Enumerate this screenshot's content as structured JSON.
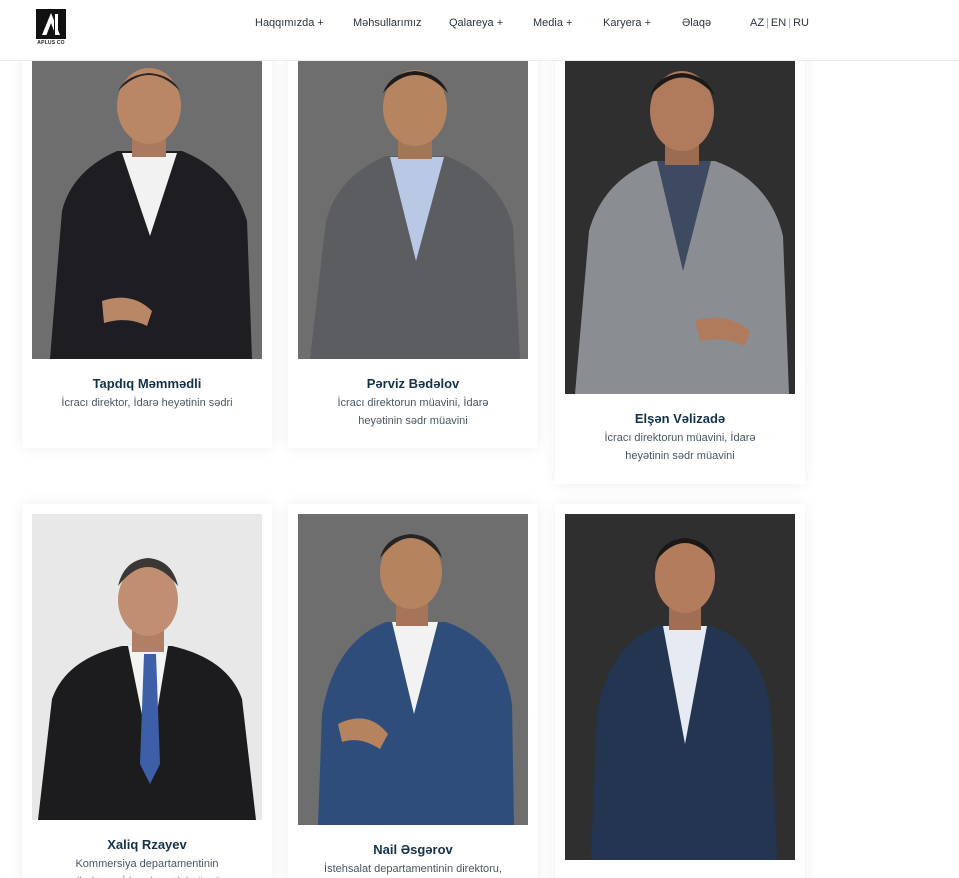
{
  "header": {
    "logo_text": "APLUS CO",
    "nav": [
      "Haqqımızda +",
      "Məhsullarımız",
      "Qalareya +",
      "Media +",
      "Karyera +",
      "Əlaqə"
    ],
    "languages": [
      "AZ",
      "EN",
      "RU"
    ]
  },
  "team": [
    {
      "name": "Tapdıq Məmmədli",
      "role": "İcracı direktor, İdarə heyətinin sədri"
    },
    {
      "name": "Pərviz Bədəlov",
      "role": "İcracı direktorun müavini, İdarə heyətinin sədr müavini"
    },
    {
      "name": "Elşən Vəlizadə",
      "role": "İcracı direktorun müavini, İdarə heyətinin sədr müavini"
    },
    {
      "name": "Xaliq Rzayev",
      "role": "Kommersiya departamentinin direktoru, İdarə heyətinin üzvü"
    },
    {
      "name": "Nail Əsgərov",
      "role": "İstehsalat departamentinin direktoru,"
    },
    {
      "name": "",
      "role": ""
    }
  ]
}
